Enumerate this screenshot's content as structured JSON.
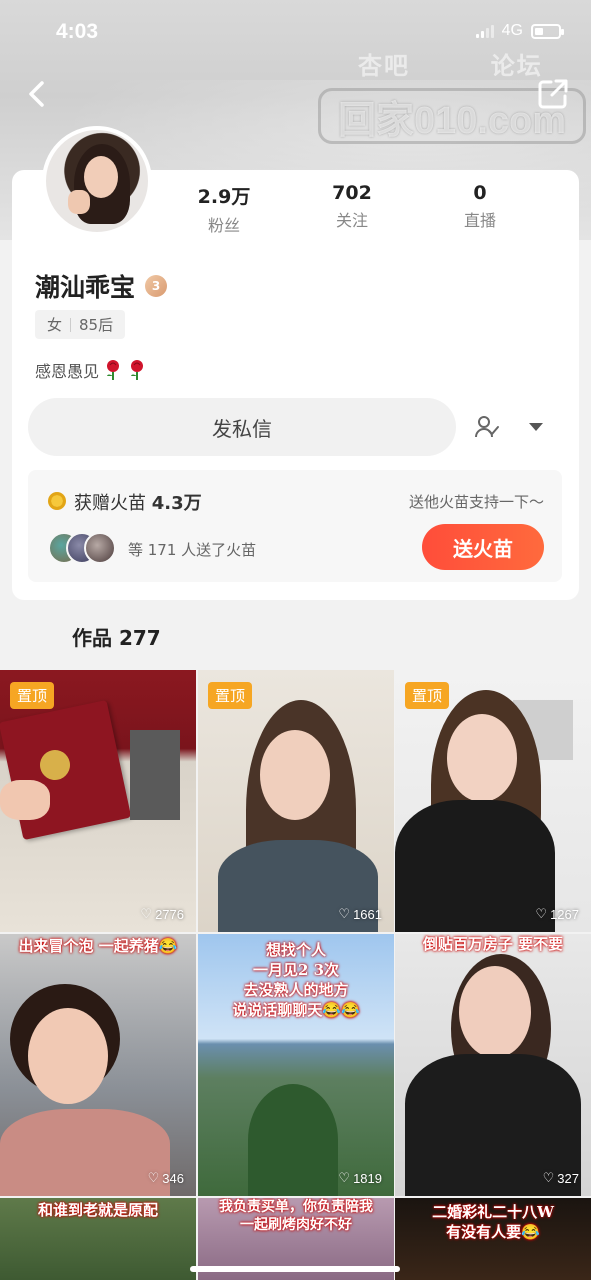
{
  "status": {
    "time": "4:03",
    "network": "4G"
  },
  "watermark": {
    "top_left": "杏吧",
    "top_right": "论坛",
    "main": "回家010.com"
  },
  "profile": {
    "name": "潮汕乖宝",
    "level": "3",
    "gender": "女",
    "age_tag": "85后",
    "bio": "感恩愚见",
    "stats": [
      {
        "value": "2.9万",
        "label": "粉丝"
      },
      {
        "value": "702",
        "label": "关注"
      },
      {
        "value": "0",
        "label": "直播"
      }
    ],
    "message_button": "发私信"
  },
  "fire": {
    "title_prefix": "获赠火苗 ",
    "amount": "4.3万",
    "hint": "送他火苗支持一下～",
    "count_text": "等 171 人送了火苗",
    "button": "送火苗"
  },
  "works": {
    "label": "作品 277",
    "pin_label": "置顶",
    "items": [
      {
        "likes": "2776",
        "pinned": true,
        "caption": ""
      },
      {
        "likes": "1661",
        "pinned": true,
        "caption": ""
      },
      {
        "likes": "1267",
        "pinned": true,
        "caption": ""
      },
      {
        "likes": "346",
        "pinned": false,
        "caption": "出来冒个泡 一起养猪😂"
      },
      {
        "likes": "1819",
        "pinned": false,
        "caption": "想找个人\n一月见2 3次\n去没熟人的地方\n说说话聊聊天😂😂"
      },
      {
        "likes": "327",
        "pinned": false,
        "caption": "倒贴百万房子 要不要"
      },
      {
        "likes": "",
        "pinned": false,
        "caption": "和谁到老就是原配"
      },
      {
        "likes": "",
        "pinned": false,
        "caption": "我负责买单，你负责陪我\n一起刷烤肉好不好"
      },
      {
        "likes": "",
        "pinned": false,
        "caption": "二婚彩礼二十八W\n有没有人要😂"
      }
    ]
  },
  "colors": {
    "accent": "#ff4d3a",
    "pin": "#f6a623"
  }
}
